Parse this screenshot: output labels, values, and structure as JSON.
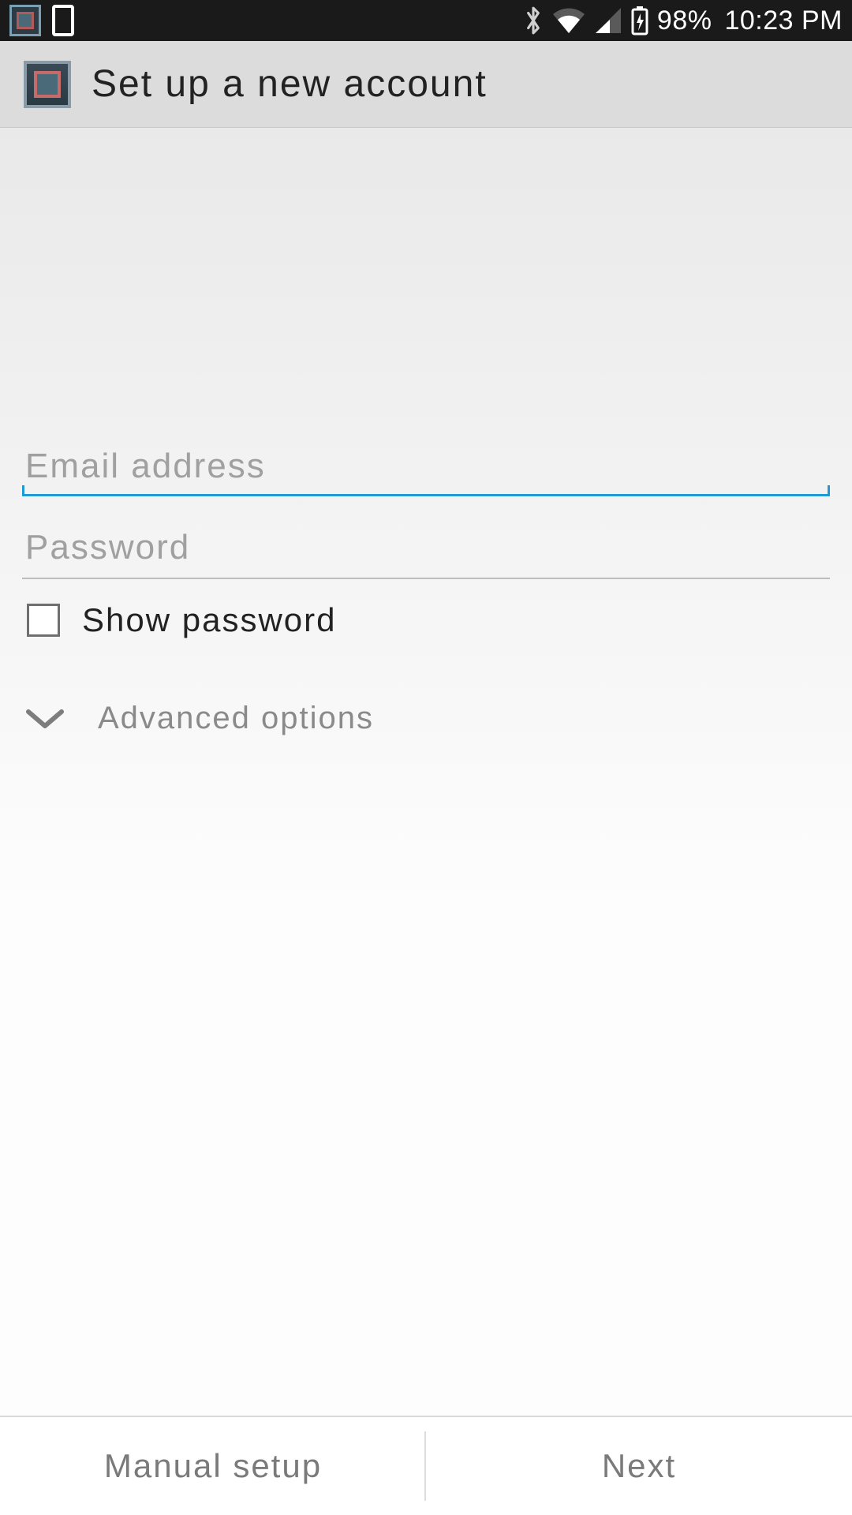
{
  "status": {
    "battery_pct": "98%",
    "time": "10:23 PM"
  },
  "header": {
    "title": "Set up a new account"
  },
  "form": {
    "email_placeholder": "Email address",
    "email_value": "",
    "password_placeholder": "Password",
    "password_value": "",
    "show_password_label": "Show password",
    "show_password_checked": false,
    "advanced_label": "Advanced options"
  },
  "footer": {
    "manual_label": "Manual setup",
    "next_label": "Next"
  }
}
